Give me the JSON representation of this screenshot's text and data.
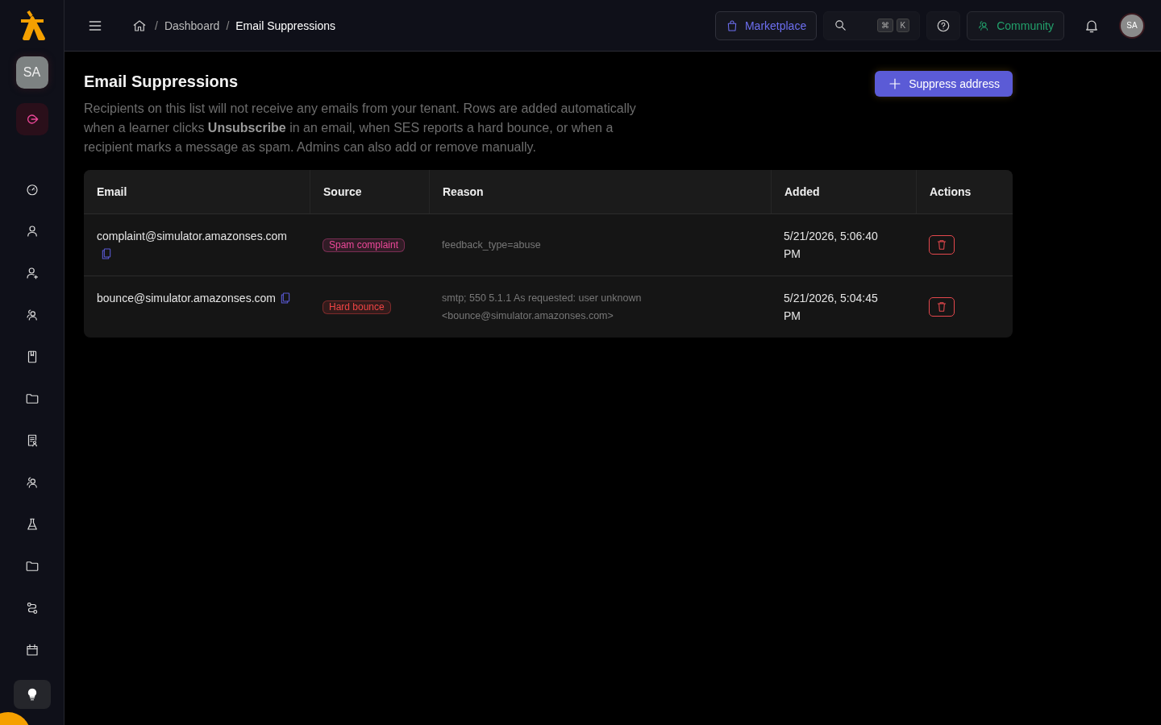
{
  "sidebar": {
    "avatar": "SA",
    "items": [
      {
        "kind": "gauge",
        "selected": false
      },
      {
        "kind": "user",
        "selected": false
      },
      {
        "kind": "user-plus",
        "selected": false
      },
      {
        "kind": "users",
        "selected": false
      },
      {
        "kind": "book",
        "selected": false
      },
      {
        "kind": "folder",
        "selected": false
      },
      {
        "kind": "certificate",
        "selected": false
      },
      {
        "kind": "users",
        "selected": false
      },
      {
        "kind": "flask",
        "selected": false
      },
      {
        "kind": "folder",
        "selected": false
      },
      {
        "kind": "route",
        "selected": false
      },
      {
        "kind": "calendar",
        "selected": false
      },
      {
        "kind": "bulb",
        "selected": true
      }
    ]
  },
  "breadcrumb": [
    {
      "separator": "/",
      "label": "Dashboard"
    },
    {
      "separator": "/",
      "label": "Email Suppressions"
    }
  ],
  "topbar": {
    "marketplace": "Marketplace",
    "shortcut": [
      "⌘",
      "K"
    ],
    "community": "Community",
    "avatar": "SA"
  },
  "page": {
    "title": "Email Suppressions",
    "description": "Recipients on this list will not receive any emails from your tenant. Rows are added automatically when a learner clicks **Unsubscribe** in an email, when SES reports a hard bounce, or when a recipient marks a message as spam. Admins can also add or remove manually.",
    "action": "Suppress address"
  },
  "table": {
    "columns": [
      "Email",
      "Source",
      "Reason",
      "Added",
      "Actions"
    ],
    "rows": [
      {
        "email": "complaint@simulator.amazonses.com",
        "source": "Spam complaint",
        "color": "#ec4899",
        "reason": "feedback_type=abuse",
        "added": "5/21/2026, 5:06:40 PM"
      },
      {
        "email": "bounce@simulator.amazonses.com",
        "source": "Hard bounce",
        "color": "#ef4444",
        "reason": "smtp; 550 5.1.1 As requested: user unknown <bounce@simulator.amazonses.com>",
        "added": "5/21/2026, 5:04:45 PM"
      }
    ]
  }
}
